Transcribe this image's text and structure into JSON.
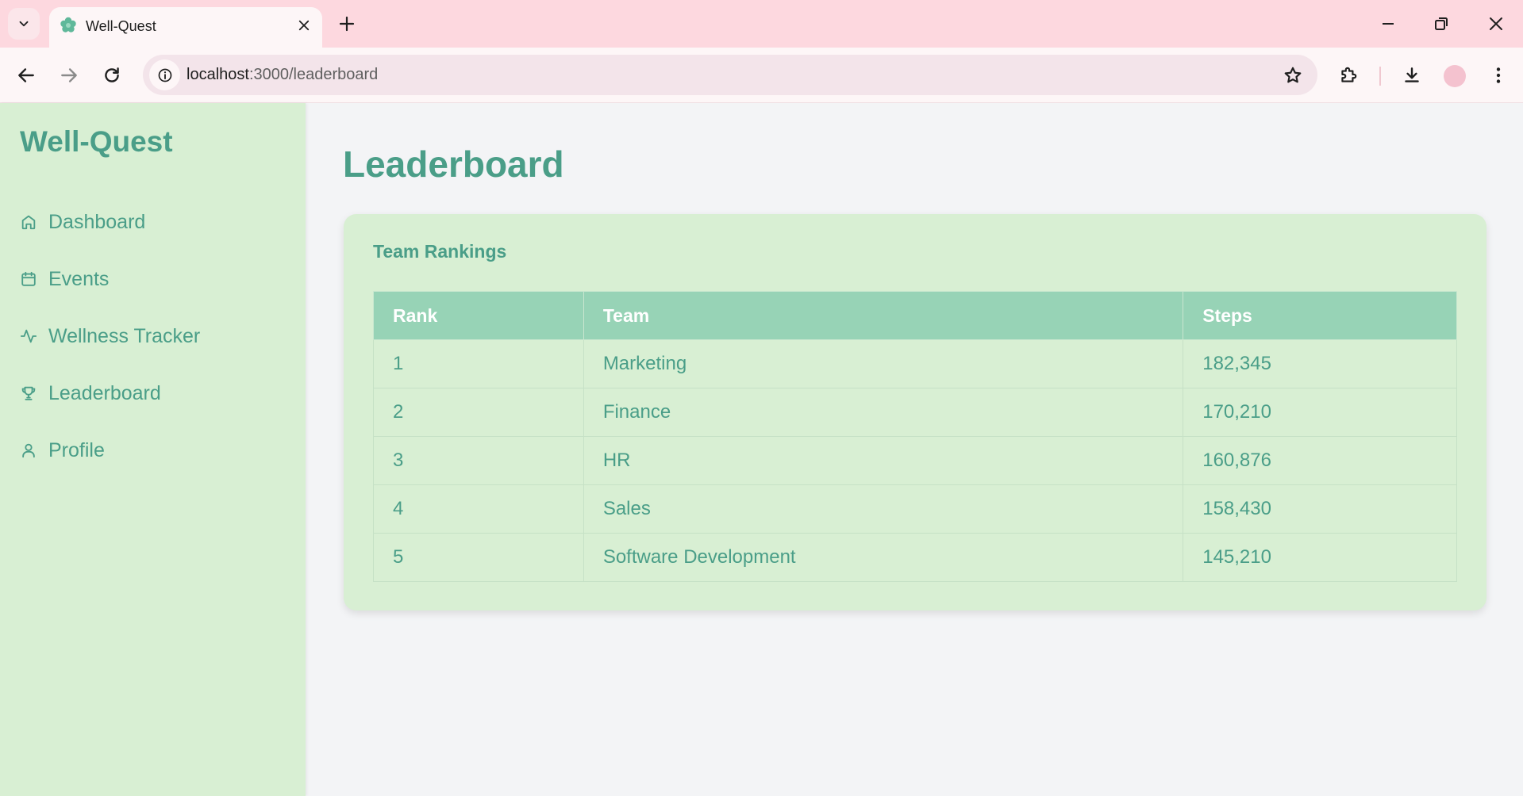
{
  "browser": {
    "tab_title": "Well-Quest",
    "url_host": "localhost",
    "url_path": ":3000/leaderboard"
  },
  "sidebar": {
    "brand": "Well-Quest",
    "items": [
      {
        "label": "Dashboard",
        "icon": "home-icon"
      },
      {
        "label": "Events",
        "icon": "calendar-icon"
      },
      {
        "label": "Wellness Tracker",
        "icon": "activity-icon"
      },
      {
        "label": "Leaderboard",
        "icon": "trophy-icon"
      },
      {
        "label": "Profile",
        "icon": "user-icon"
      }
    ]
  },
  "main": {
    "title": "Leaderboard",
    "card_title": "Team Rankings",
    "columns": [
      "Rank",
      "Team",
      "Steps"
    ],
    "rows": [
      [
        "1",
        "Marketing",
        "182,345"
      ],
      [
        "2",
        "Finance",
        "170,210"
      ],
      [
        "3",
        "HR",
        "160,876"
      ],
      [
        "4",
        "Sales",
        "158,430"
      ],
      [
        "5",
        "Software Development",
        "145,210"
      ]
    ]
  },
  "colors": {
    "accent": "#4a9e88",
    "sidebar_bg": "#d8efd3",
    "table_header_bg": "#97d3b6",
    "tabbar_bg": "#fdd8df"
  }
}
